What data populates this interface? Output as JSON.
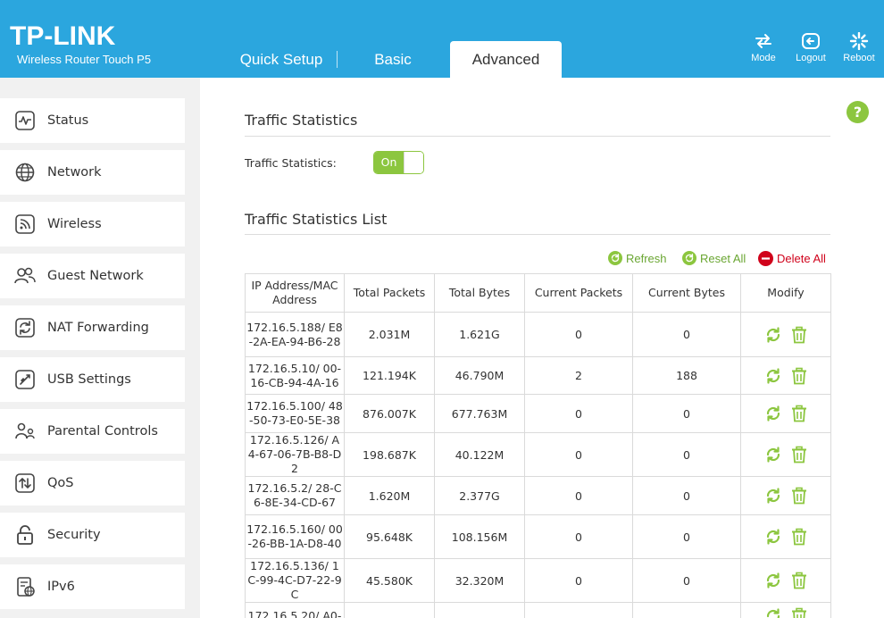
{
  "header": {
    "logo": "TP-LINK",
    "model": "Wireless Router Touch P5",
    "tabs": [
      {
        "label": "Quick Setup",
        "active": false
      },
      {
        "label": "Basic",
        "active": false
      },
      {
        "label": "Advanced",
        "active": true
      }
    ],
    "buttons": {
      "mode": "Mode",
      "logout": "Logout",
      "reboot": "Reboot"
    }
  },
  "sidebar": {
    "items": [
      {
        "label": "Status",
        "icon": "status-icon"
      },
      {
        "label": "Network",
        "icon": "globe-icon"
      },
      {
        "label": "Wireless",
        "icon": "wireless-icon"
      },
      {
        "label": "Guest Network",
        "icon": "guest-users-icon"
      },
      {
        "label": "NAT Forwarding",
        "icon": "nat-forwarding-icon"
      },
      {
        "label": "USB Settings",
        "icon": "usb-icon"
      },
      {
        "label": "Parental Controls",
        "icon": "parental-controls-icon"
      },
      {
        "label": "QoS",
        "icon": "qos-icon"
      },
      {
        "label": "Security",
        "icon": "lock-icon"
      },
      {
        "label": "IPv6",
        "icon": "ipv6-icon"
      }
    ]
  },
  "main": {
    "help": "?",
    "section_title": "Traffic Statistics",
    "toggle_label": "Traffic Statistics:",
    "toggle_state": "On",
    "list_title": "Traffic Statistics List",
    "actions": {
      "refresh": "Refresh",
      "reset_all": "Reset All",
      "delete_all": "Delete All"
    },
    "colors": {
      "header_blue": "#2ba6de",
      "accent_green": "#8cc63f",
      "delete_red": "#d0021b"
    },
    "table": {
      "columns": [
        "IP Address/MAC Address",
        "Total Packets",
        "Total Bytes",
        "Current Packets",
        "Current Bytes",
        "Modify"
      ],
      "rows": [
        {
          "ip": "172.16.5.188/ E8-2A-EA-94-B6-28",
          "total_packets": "2.031M",
          "total_bytes": "1.621G",
          "current_packets": "0",
          "current_bytes": "0"
        },
        {
          "ip": "172.16.5.10/ 00-16-CB-94-4A-16",
          "total_packets": "121.194K",
          "total_bytes": "46.790M",
          "current_packets": "2",
          "current_bytes": "188"
        },
        {
          "ip": "172.16.5.100/ 48-50-73-E0-5E-38",
          "total_packets": "876.007K",
          "total_bytes": "677.763M",
          "current_packets": "0",
          "current_bytes": "0"
        },
        {
          "ip": "172.16.5.126/ A4-67-06-7B-B8-D2",
          "total_packets": "198.687K",
          "total_bytes": "40.122M",
          "current_packets": "0",
          "current_bytes": "0"
        },
        {
          "ip": "172.16.5.2/ 28-C6-8E-34-CD-67",
          "total_packets": "1.620M",
          "total_bytes": "2.377G",
          "current_packets": "0",
          "current_bytes": "0"
        },
        {
          "ip": "172.16.5.160/ 00-26-BB-1A-D8-40",
          "total_packets": "95.648K",
          "total_bytes": "108.156M",
          "current_packets": "0",
          "current_bytes": "0"
        },
        {
          "ip": "172.16.5.136/ 1C-99-4C-D7-22-9C",
          "total_packets": "45.580K",
          "total_bytes": "32.320M",
          "current_packets": "0",
          "current_bytes": "0"
        },
        {
          "ip": "172.16.5.20/ A0-",
          "total_packets": "",
          "total_bytes": "",
          "current_packets": "",
          "current_bytes": ""
        }
      ]
    }
  }
}
